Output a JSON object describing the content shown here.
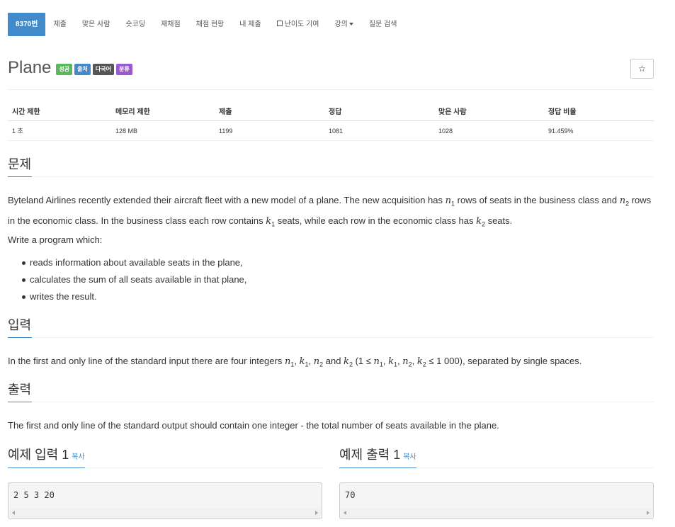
{
  "nav": {
    "items": [
      "8370번",
      "제출",
      "맞은 사람",
      "숏코딩",
      "재채점",
      "채점 현황",
      "내 제출",
      "난이도 기여",
      "강의",
      "질문 검색"
    ]
  },
  "problem": {
    "title": "Plane",
    "labels": [
      {
        "text": "성공",
        "color": "#5cb85c"
      },
      {
        "text": "출처",
        "color": "#428bca"
      },
      {
        "text": "다국어",
        "color": "#555555"
      },
      {
        "text": "분류",
        "color": "#9b59d0"
      }
    ],
    "star": "☆"
  },
  "stats": {
    "headers": [
      "시간 제한",
      "메모리 제한",
      "제출",
      "정답",
      "맞은 사람",
      "정답 비율"
    ],
    "values": [
      "1 초",
      "128 MB",
      "1199",
      "1081",
      "1028",
      "91.459%"
    ]
  },
  "sections": {
    "problem_heading": "문제",
    "input_heading": "입력",
    "output_heading": "출력"
  },
  "description": {
    "p1_a": "Byteland Airlines recently extended their aircraft fleet with a new model of a plane. The new acquisition has ",
    "p1_b": " rows of seats in the business class and ",
    "p1_c": " rows in the economic class. In the business class each row contains ",
    "p1_d": " seats, while each row in the economic class has ",
    "p1_e": " seats.",
    "p2": "Write a program which:",
    "bullets": [
      "reads information about available seats in the plane,",
      "calculates the sum of all seats available in that plane,",
      "writes the result."
    ]
  },
  "input_text": {
    "a": "In the first and only line of the standard input there are four integers ",
    "b": " and ",
    "c": " (1 ≤ ",
    "d": " ≤ 1 000), separated by single spaces."
  },
  "output_text": "The first and only line of the standard output should contain one integer - the total number of seats available in the plane.",
  "samples": {
    "input_title": "예제 입력 1",
    "output_title": "예제 출력 1",
    "copy_label": "복사",
    "input_value": "2 5 3 20",
    "output_value": "70"
  },
  "accent_color": "#428bca"
}
